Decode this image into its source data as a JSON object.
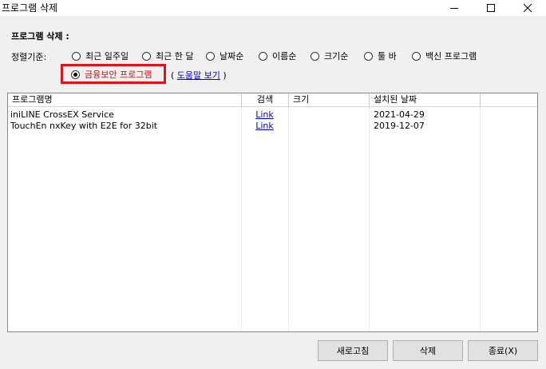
{
  "window": {
    "title": "프로그램 삭제"
  },
  "section": {
    "title": "프로그램 삭제 :"
  },
  "sort": {
    "label": "정렬기준:",
    "options": [
      {
        "label": "최근 일주일",
        "checked": false
      },
      {
        "label": "최근 한 달",
        "checked": false
      },
      {
        "label": "날짜순",
        "checked": false
      },
      {
        "label": "이름순",
        "checked": false
      },
      {
        "label": "크기순",
        "checked": false
      },
      {
        "label": "툴 바",
        "checked": false
      },
      {
        "label": "백신 프로그램",
        "checked": false
      },
      {
        "label": "금융보안 프로그램",
        "checked": true
      }
    ],
    "help_open": "(",
    "help_link": "도움말 보기",
    "help_close": ")"
  },
  "table": {
    "columns": [
      "프로그램명",
      "검색",
      "크기",
      "설치된 날짜"
    ],
    "rows": [
      {
        "name": "iniLINE CrossEX Service",
        "search": "Link",
        "size": "",
        "date": "2021-04-29"
      },
      {
        "name": "TouchEn nxKey with E2E for 32bit",
        "search": "Link",
        "size": "",
        "date": "2019-12-07"
      }
    ]
  },
  "buttons": {
    "refresh": "새로고침",
    "delete": "삭제",
    "exit": "종료(X)"
  },
  "colors": {
    "highlight": "#e1121b",
    "link": "#0000ee"
  }
}
